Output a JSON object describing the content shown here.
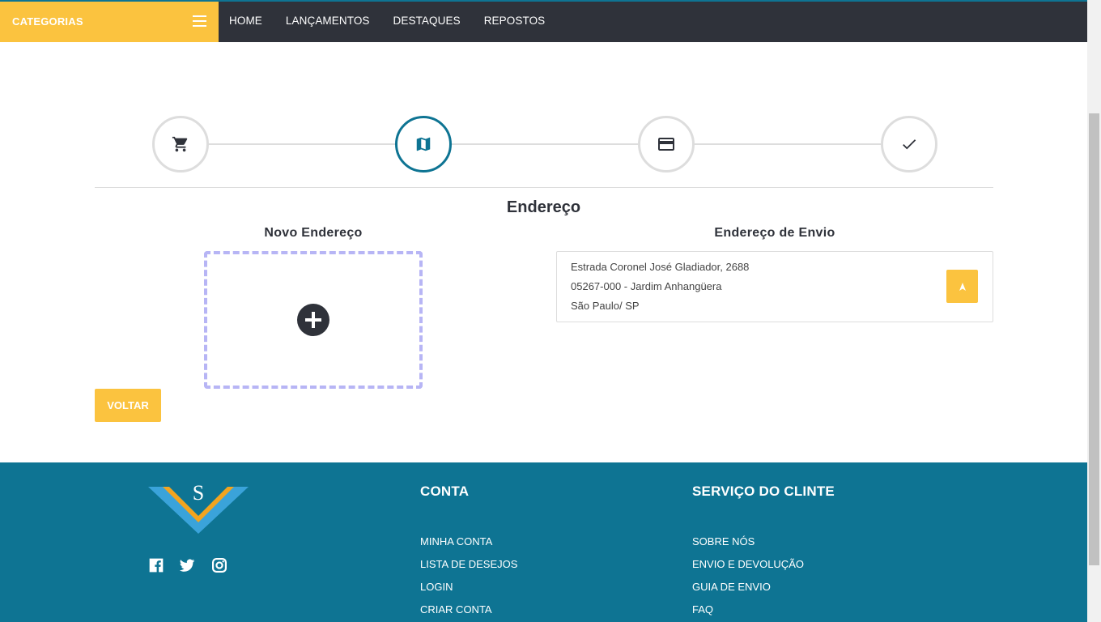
{
  "navbar": {
    "categories_label": "CATEGORIAS",
    "links": [
      "HOME",
      "LANÇAMENTOS",
      "DESTAQUES",
      "REPOSTOS"
    ]
  },
  "steps": [
    {
      "icon": "cart-icon",
      "active": false
    },
    {
      "icon": "map-icon",
      "active": true
    },
    {
      "icon": "credit-card-icon",
      "active": false
    },
    {
      "icon": "check-icon",
      "active": false
    }
  ],
  "main": {
    "title": "Endereço",
    "new_address_title": "Novo Endereço",
    "shipping_address_title": "Endereço de Envio",
    "address": {
      "line1": "Estrada Coronel José Gladiador, 2688",
      "line2": "05267-000 - Jardim Anhangüera",
      "line3": "São Paulo/ SP"
    },
    "back_button": "VOLTAR"
  },
  "footer": {
    "logo_letter": "S",
    "account": {
      "title": "CONTA",
      "links": [
        "MINHA CONTA",
        "LISTA DE DESEJOS",
        "LOGIN",
        "CRIAR CONTA"
      ]
    },
    "service": {
      "title": "SERVIÇO DO CLINTE",
      "links": [
        "SOBRE NÓS",
        "ENVIO E DEVOLUÇÃO",
        "GUIA DE ENVIO",
        "FAQ"
      ]
    }
  },
  "colors": {
    "accent_yellow": "#fbc33f",
    "dark": "#2f323a",
    "teal": "#0e7493",
    "dashed_border": "#b7b5f5"
  }
}
